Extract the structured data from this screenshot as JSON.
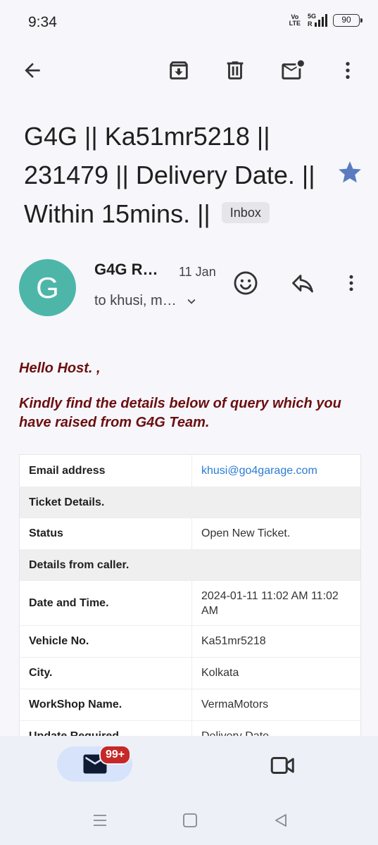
{
  "status_bar": {
    "time": "9:34",
    "volte_top": "Vo",
    "volte_bottom": "LTE",
    "network": "5G",
    "roaming": "R",
    "battery": "90"
  },
  "toolbar": {
    "back_icon": "arrow-left-icon",
    "archive_icon": "archive-icon",
    "delete_icon": "trash-icon",
    "mark_unread_icon": "mark-unread-icon",
    "more_icon": "more-vert-icon"
  },
  "email": {
    "subject": "G4G || Ka51mr5218 || 231479 || Delivery Date. || Within 15mins. ||",
    "label": "Inbox",
    "starred": true,
    "star_color": "#5b7bc0"
  },
  "sender": {
    "initial": "G",
    "avatar_color": "#4db6a9",
    "name": "G4G R…",
    "date": "11 Jan",
    "recipients": "to khusi, m…"
  },
  "body": {
    "greeting": "Hello Host. ,",
    "intro": "Kindly find the details below of query which you have raised from G4G Team.",
    "text_color": "#6b0f0f",
    "rows": [
      {
        "label": "Email address",
        "value": "khusi@go4garage.com",
        "type": "link"
      },
      {
        "label": "Ticket Details.",
        "value": "",
        "type": "section"
      },
      {
        "label": "Status",
        "value": "Open New Ticket.",
        "type": "row"
      },
      {
        "label": "Details from caller.",
        "value": "",
        "type": "section"
      },
      {
        "label": "Date and Time.",
        "value": "2024-01-11 11:02 AM 11:02 AM",
        "type": "row"
      },
      {
        "label": "Vehicle No.",
        "value": "Ka51mr5218",
        "type": "row"
      },
      {
        "label": "City.",
        "value": "Kolkata",
        "type": "row"
      },
      {
        "label": "WorkShop Name.",
        "value": "VermaMotors",
        "type": "row"
      },
      {
        "label": "Update Required",
        "value": "Delivery Date",
        "type": "row"
      }
    ]
  },
  "bottom_nav": {
    "mail_icon": "mail-icon",
    "badge": "99+",
    "meet_icon": "video-camera-icon"
  }
}
